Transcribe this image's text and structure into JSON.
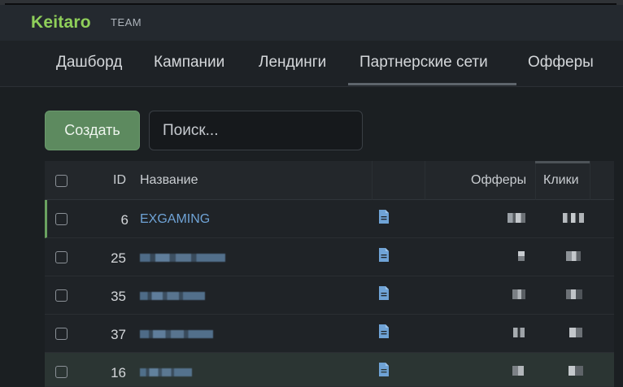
{
  "header": {
    "logo": "Keitaro",
    "team": "TEAM"
  },
  "nav": {
    "tabs": [
      {
        "label": "Дашборд"
      },
      {
        "label": "Кампании"
      },
      {
        "label": "Лендинги"
      },
      {
        "label": "Партнерские сети",
        "active": true
      },
      {
        "label": "Офферы"
      }
    ]
  },
  "toolbar": {
    "create_label": "Создать",
    "search_placeholder": "Поиск..."
  },
  "table": {
    "columns": {
      "id": "ID",
      "name": "Название",
      "offers": "Офферы",
      "clicks": "Клики"
    },
    "rows": [
      {
        "id": "6",
        "name": "EXGAMING",
        "name_hidden": false
      },
      {
        "id": "25",
        "name": "",
        "name_hidden": true
      },
      {
        "id": "35",
        "name": "",
        "name_hidden": true
      },
      {
        "id": "37",
        "name": "",
        "name_hidden": true
      },
      {
        "id": "16",
        "name": "",
        "name_hidden": true
      }
    ]
  },
  "colors": {
    "brand": "#8fcf5a",
    "create_button": "#5d8a5f",
    "link": "#6fa3d6",
    "active_row_marker": "#6aa260"
  },
  "icons": {
    "row_action": "document-icon"
  }
}
